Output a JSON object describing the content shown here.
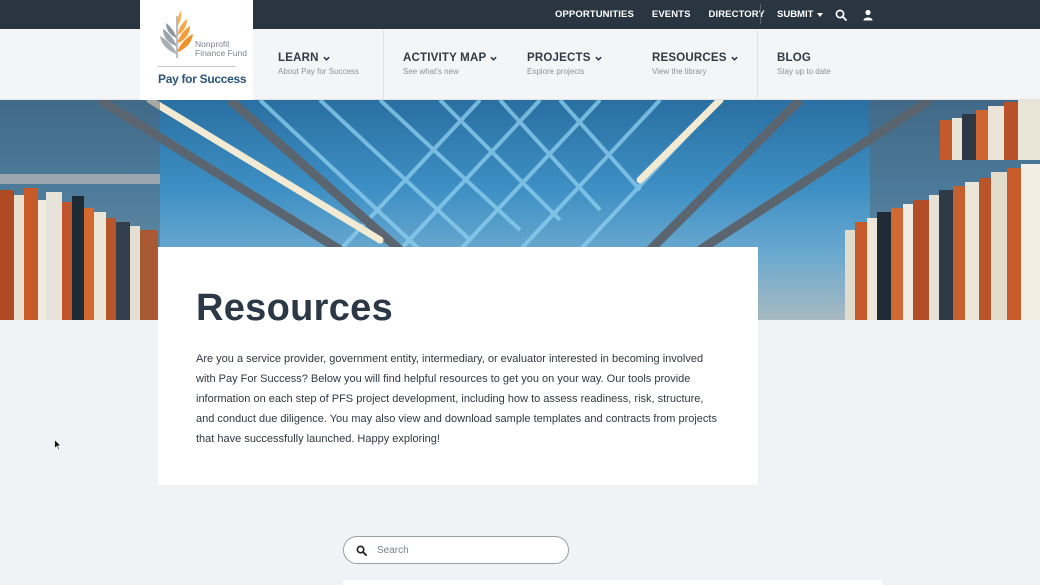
{
  "topbar": {
    "links": [
      "OPPORTUNITIES",
      "EVENTS",
      "DIRECTORY"
    ],
    "submit_label": "SUBMIT",
    "icons": [
      "search-icon",
      "user-icon"
    ]
  },
  "logo": {
    "org": "Nonprofit Finance Fund",
    "tagline": "Pay for Success"
  },
  "nav": {
    "items": [
      {
        "label": "LEARN",
        "sub": "About Pay for Success",
        "dropdown": true
      },
      {
        "label": "ACTIVITY MAP",
        "sub": "See what's new",
        "dropdown": true
      },
      {
        "label": "PROJECTS",
        "sub": "Explore projects",
        "dropdown": true
      },
      {
        "label": "RESOURCES",
        "sub": "View the library",
        "dropdown": true
      },
      {
        "label": "BLOG",
        "sub": "Stay up to date",
        "dropdown": false
      }
    ]
  },
  "page": {
    "title": "Resources",
    "intro": "Are you a service provider, government entity, intermediary, or evaluator interested in becoming involved with Pay For Success? Below you will find helpful resources to get you on your way. Our tools provide information on each step of PFS project development, including how to assess readiness, risk, structure, and conduct due diligence. You may also view and download sample templates and contracts from projects that have successfully launched. Happy exploring!"
  },
  "search": {
    "placeholder": "Search",
    "value": ""
  },
  "colors": {
    "topbar": "#293541",
    "nav_bg": "#f4f5f7",
    "page_bg": "#f1f2f5",
    "logo_accent": "#f0922b",
    "brand_blue": "#2b5479"
  }
}
